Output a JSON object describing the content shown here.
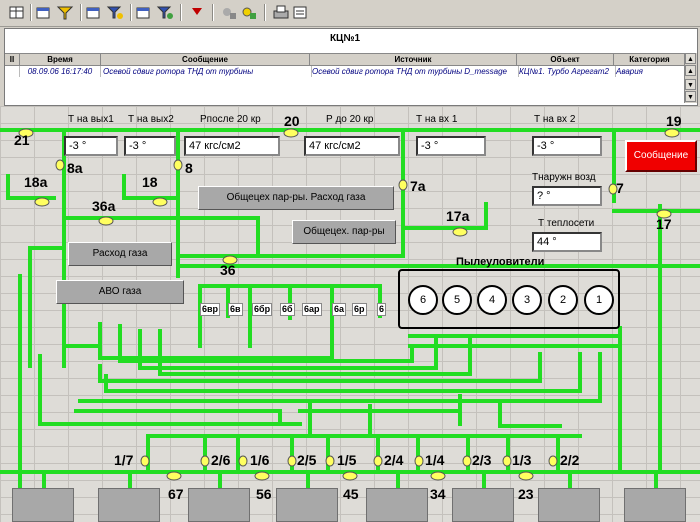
{
  "alarm": {
    "title": "КЦ№1",
    "headers": [
      "II",
      "Время",
      "Сообщение",
      "Источник",
      "Объект",
      "Категория"
    ],
    "row": {
      "time": "08.09.06 16:17:40",
      "message": "Осевой сдвиг ротора ТНД от турбины",
      "source": "Осевой сдвиг ротора ТНД от турбины D_message",
      "object": "КЦ№1. Турбо Агрегат2",
      "category": "Авария"
    }
  },
  "scroll": {
    "up": "▲",
    "top": "▲",
    "down": "▼",
    "bottom": "▼"
  },
  "mimic": {
    "labels": {
      "t_out1": "Т на вых1",
      "t_out2": "Т на вых2",
      "p_after": "Рпосле 20 кр",
      "p_before": "Р до 20 кр",
      "t_in1": "Т на вх 1",
      "t_in2": "Т на вх 2",
      "t_outdoor": "Тнаружн возд",
      "t_heat": "Т теплосети",
      "dust": "Пылеуловители"
    },
    "values": {
      "t_out1": "-3 °",
      "t_out2": "-3 °",
      "p_after": "47 кгс/см2",
      "p_before": "47 кгс/см2",
      "t_in1": "-3 °",
      "t_in2": "-3 °",
      "t_outdoor": "? °",
      "t_heat": "44 °"
    },
    "buttons": {
      "message": "Сообщение",
      "gas_flow_common": "Общецех пар-ры. Расход газа",
      "common_params": "Общецех. пар-ры",
      "gas_flow": "Расход газа",
      "avo": "АВО газа"
    },
    "valves": {
      "v21": "21",
      "v20": "20",
      "v19": "19",
      "v8a": "8а",
      "v8": "8",
      "v18a": "18а",
      "v18": "18",
      "v7a": "7а",
      "v7": "7",
      "v36a": "36а",
      "v36": "36",
      "v17a": "17а",
      "v17": "17"
    },
    "tags": [
      "6вр",
      "6в",
      "6бр",
      "6б",
      "6ар",
      "6а",
      "6р",
      "6"
    ],
    "dust_collectors": [
      "6",
      "5",
      "4",
      "3",
      "2",
      "1"
    ],
    "bottom_valves": [
      "1/7",
      "2/6",
      "1/6",
      "2/5",
      "1/5",
      "2/4",
      "1/4",
      "2/3",
      "1/3",
      "2/2"
    ],
    "bottom_numbers": [
      "67",
      "56",
      "45",
      "34",
      "23"
    ]
  },
  "colors": {
    "pipe": "#22dd22",
    "alarm_button": "#f00000",
    "alarm_text": "#000080"
  }
}
